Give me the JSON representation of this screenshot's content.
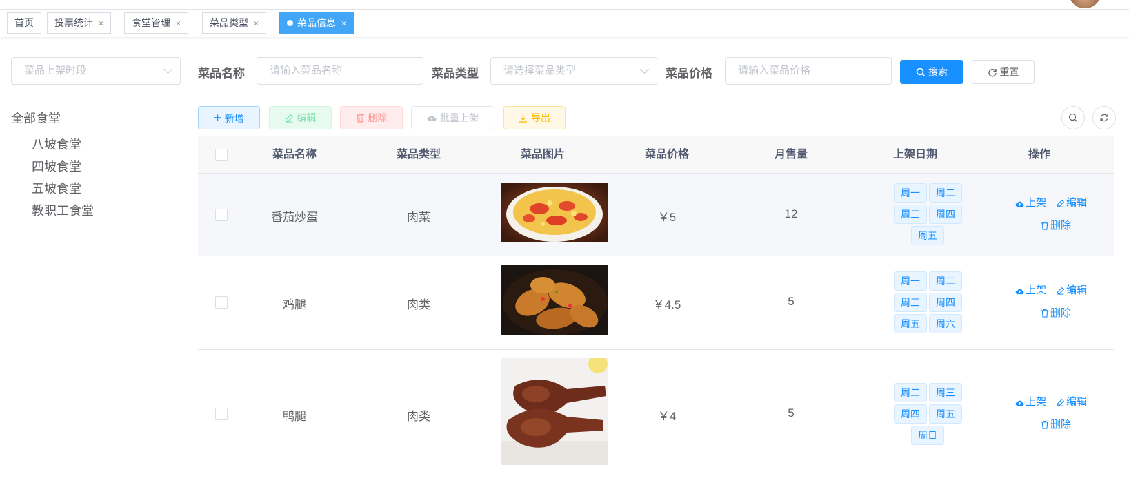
{
  "tags": [
    {
      "label": "首页",
      "closable": false,
      "active": false
    },
    {
      "label": "投票统计",
      "closable": true,
      "active": false
    },
    {
      "label": "食堂管理",
      "closable": true,
      "active": false
    },
    {
      "label": "菜品类型",
      "closable": true,
      "active": false
    },
    {
      "label": "菜品信息",
      "closable": true,
      "active": true
    }
  ],
  "close_glyph": "×",
  "sidebar": {
    "date_placeholder": "菜品上架时段",
    "tree_root": "全部食堂",
    "tree_items": [
      "八坡食堂",
      "四坡食堂",
      "五坡食堂",
      "教职工食堂"
    ]
  },
  "search": {
    "name_label": "菜品名称",
    "name_placeholder": "请输入菜品名称",
    "type_label": "菜品类型",
    "type_placeholder": "请选择菜品类型",
    "price_label": "菜品价格",
    "price_placeholder": "请输入菜品价格",
    "search_btn": "搜索",
    "reset_btn": "重置"
  },
  "toolbar": {
    "add": "新增",
    "edit": "编辑",
    "delete": "删除",
    "batch": "批量上架",
    "export": "导出"
  },
  "table": {
    "headers": [
      "菜品名称",
      "菜品类型",
      "菜品图片",
      "菜品价格",
      "月售量",
      "上架日期",
      "操作"
    ],
    "rows": [
      {
        "name": "番茄炒蛋",
        "type": "肉菜",
        "price": "￥5",
        "sales": "12",
        "days": [
          "周一",
          "周二",
          "周三",
          "周四",
          "周五"
        ],
        "image": "tomato-egg"
      },
      {
        "name": "鸡腿",
        "type": "肉类",
        "price": "￥4.5",
        "sales": "5",
        "days": [
          "周一",
          "周二",
          "周三",
          "周四",
          "周五",
          "周六"
        ],
        "image": "chicken-leg"
      },
      {
        "name": "鸭腿",
        "type": "肉类",
        "price": "￥4",
        "sales": "5",
        "days": [
          "周二",
          "周三",
          "周四",
          "周五",
          "周日"
        ],
        "image": "duck-leg"
      }
    ],
    "ops": {
      "up": "上架",
      "edit": "编辑",
      "delete": "删除"
    }
  },
  "colors": {
    "primary": "#1890ff",
    "tag_active": "#42a5f5",
    "success": "#13ce66",
    "danger": "#ff4949",
    "warning": "#ffba00"
  }
}
